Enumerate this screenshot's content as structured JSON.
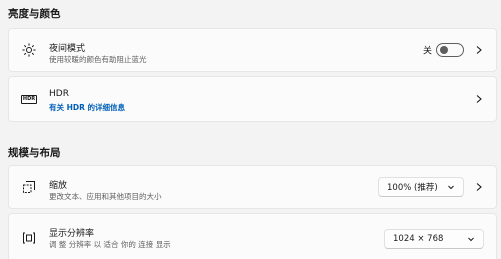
{
  "sections": {
    "brightness_color": "亮度与颜色",
    "scale_layout": "规模与布局"
  },
  "night_light": {
    "title": "夜间模式",
    "subtitle": "使用较暖的颜色有助阻止蓝光",
    "toggle_state": "关",
    "enabled": false,
    "icon": "brightness-icon"
  },
  "hdr": {
    "title": "HDR",
    "subtitle": "有关 HDR 的详细信息",
    "icon_text": "HDR"
  },
  "scale": {
    "title": "缩放",
    "subtitle": "更改文本、应用和其他项目的大小",
    "selected": "100% (推荐)",
    "icon": "scale-icon"
  },
  "resolution": {
    "title": "显示分辨率",
    "subtitle": "调 整 分辨率 以 适合 你的 连接 显示",
    "selected": "1024 × 768",
    "icon": "resolution-icon"
  },
  "colors": {
    "background": "#f3f3f3",
    "card": "#fbfbfb",
    "link": "#005fb8"
  }
}
